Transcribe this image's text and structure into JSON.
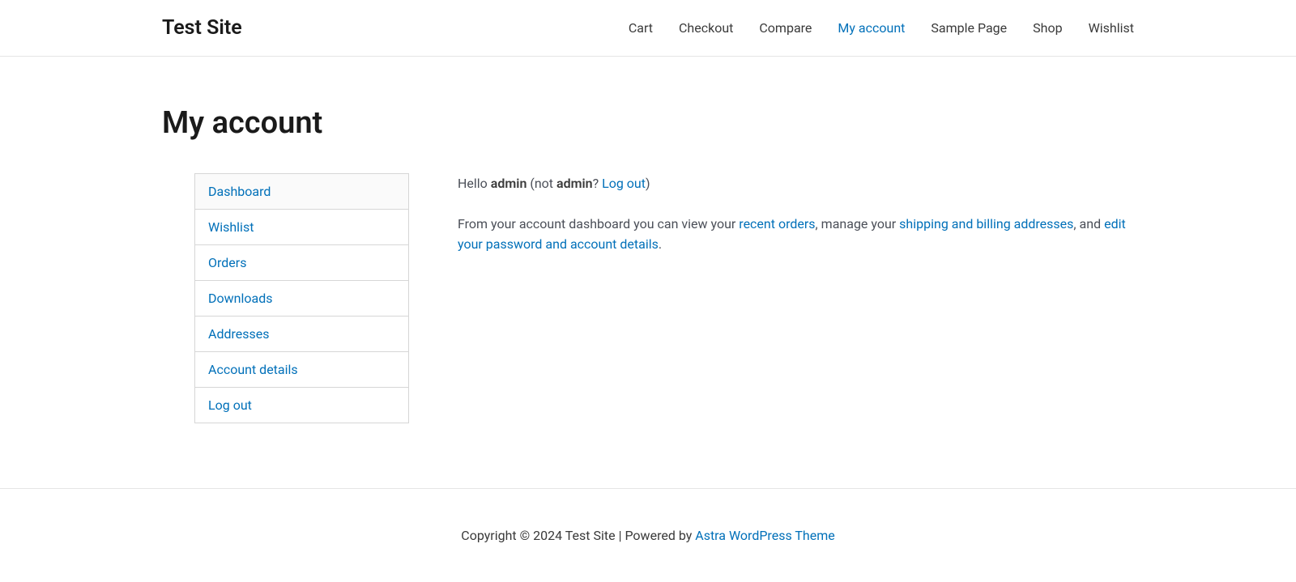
{
  "site_title": "Test Site",
  "nav": {
    "cart": "Cart",
    "checkout": "Checkout",
    "compare": "Compare",
    "my_account": "My account",
    "sample_page": "Sample Page",
    "shop": "Shop",
    "wishlist": "Wishlist"
  },
  "page_title": "My account",
  "sidebar": {
    "dashboard": "Dashboard",
    "wishlist": "Wishlist",
    "orders": "Orders",
    "downloads": "Downloads",
    "addresses": "Addresses",
    "account_details": "Account details",
    "logout": "Log out"
  },
  "greeting": {
    "hello": "Hello ",
    "username": "admin",
    "not_open": " (not ",
    "username2": "admin",
    "question": "? ",
    "logout_link": "Log out",
    "close": ")"
  },
  "dashboard_text": {
    "part1": "From your account dashboard you can view your ",
    "link1": "recent orders",
    "part2": ", manage your ",
    "link2": "shipping and billing addresses",
    "part3": ", and ",
    "link3": "edit your password and account details",
    "part4": "."
  },
  "footer": {
    "text": "Copyright © 2024 Test Site | Powered by ",
    "link": "Astra WordPress Theme"
  }
}
